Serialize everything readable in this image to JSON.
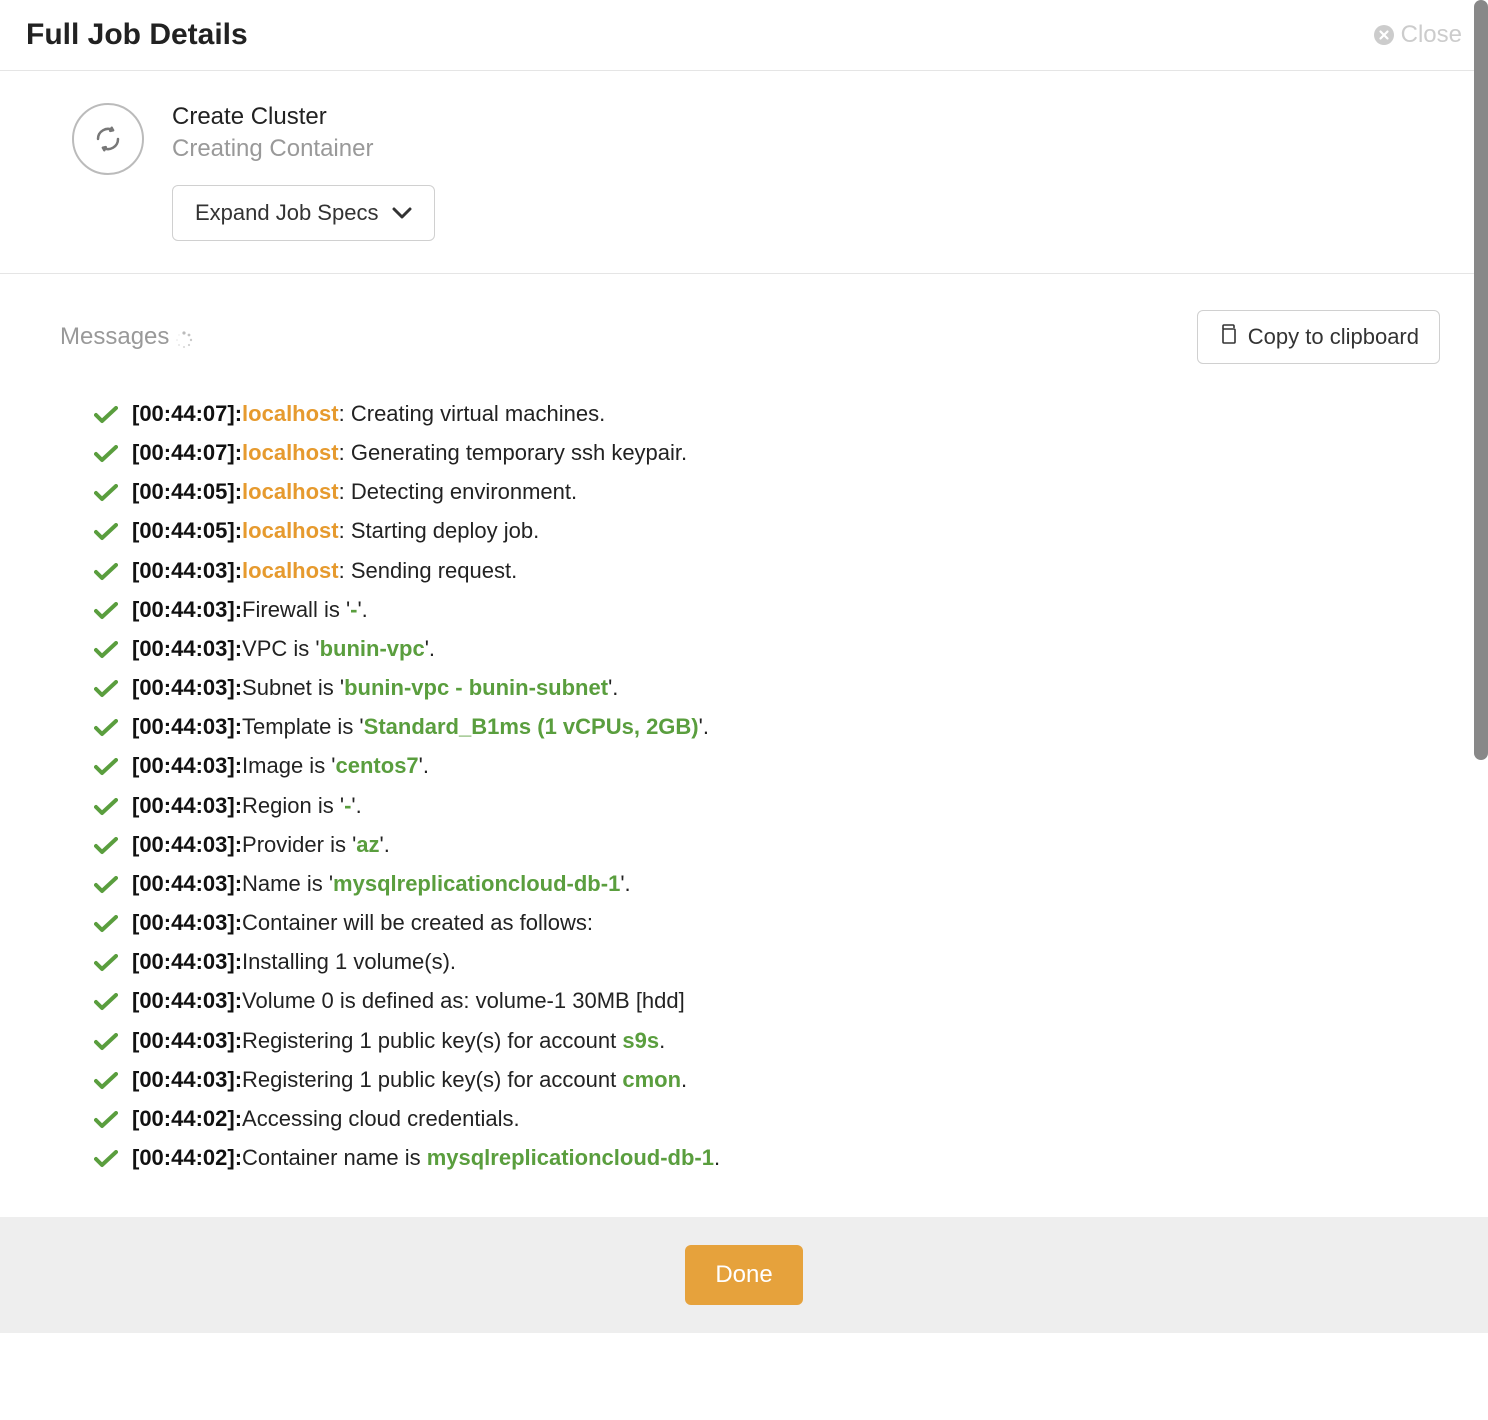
{
  "header": {
    "title": "Full Job Details",
    "close_label": "Close"
  },
  "job": {
    "title": "Create Cluster",
    "subtitle": "Creating Container",
    "expand_label": "Expand Job Specs"
  },
  "messages_section": {
    "title": "Messages",
    "copy_label": "Copy to clipboard"
  },
  "footer": {
    "done_label": "Done"
  },
  "log": [
    {
      "ts": "[00:44:07]:",
      "host": "localhost",
      "pre": ": ",
      "text": "Creating virtual machines."
    },
    {
      "ts": "[00:44:07]:",
      "host": "localhost",
      "pre": ": ",
      "text": "Generating temporary ssh keypair."
    },
    {
      "ts": "[00:44:05]:",
      "host": "localhost",
      "pre": ": ",
      "text": "Detecting environment."
    },
    {
      "ts": "[00:44:05]:",
      "host": "localhost",
      "pre": ": ",
      "text": "Starting deploy job."
    },
    {
      "ts": "[00:44:03]:",
      "host": "localhost",
      "pre": ": ",
      "text": "Sending request."
    },
    {
      "ts": "[00:44:03]:",
      "pre": "Firewall is '",
      "green": "-",
      "post": "'."
    },
    {
      "ts": "[00:44:03]:",
      "pre": "VPC is '",
      "green": "bunin-vpc",
      "post": "'."
    },
    {
      "ts": "[00:44:03]:",
      "pre": "Subnet is '",
      "green": "bunin-vpc - bunin-subnet",
      "post": "'."
    },
    {
      "ts": "[00:44:03]:",
      "pre": "Template is '",
      "green": "Standard_B1ms (1 vCPUs, 2GB)",
      "post": "'."
    },
    {
      "ts": "[00:44:03]:",
      "pre": "Image is '",
      "green": "centos7",
      "post": "'."
    },
    {
      "ts": "[00:44:03]:",
      "pre": "Region is '",
      "green": "-",
      "post": "'."
    },
    {
      "ts": "[00:44:03]:",
      "pre": "Provider is '",
      "green": "az",
      "post": "'."
    },
    {
      "ts": "[00:44:03]:",
      "pre": "Name is '",
      "green": "mysqlreplicationcloud-db-1",
      "post": "'."
    },
    {
      "ts": "[00:44:03]:",
      "text": "Container will be created as follows:"
    },
    {
      "ts": "[00:44:03]:",
      "text": "Installing 1 volume(s)."
    },
    {
      "ts": "[00:44:03]:",
      "text": "Volume 0 is defined as: volume-1 30MB [hdd]"
    },
    {
      "ts": "[00:44:03]:",
      "pre": "Registering 1 public key(s) for account ",
      "green": "s9s",
      "post": "."
    },
    {
      "ts": "[00:44:03]:",
      "pre": "Registering 1 public key(s) for account ",
      "green": "cmon",
      "post": "."
    },
    {
      "ts": "[00:44:02]:",
      "text": "Accessing cloud credentials."
    },
    {
      "ts": "[00:44:02]:",
      "pre": "Container name is ",
      "green": "mysqlreplicationcloud-db-1",
      "post": "."
    }
  ]
}
